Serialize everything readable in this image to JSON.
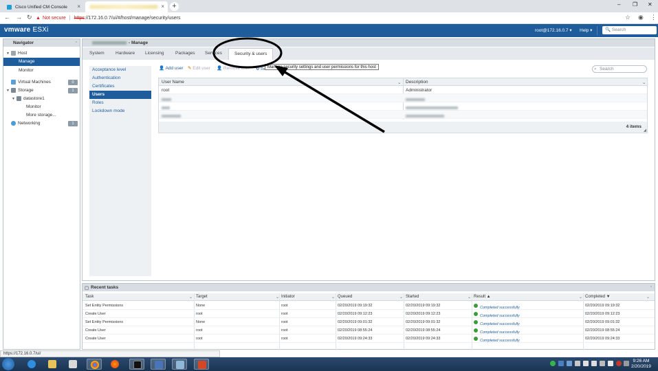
{
  "browser": {
    "tabs": [
      {
        "title": "Cisco Unified CM Console",
        "active": false
      },
      {
        "title": "",
        "active": true
      }
    ],
    "address": {
      "warning": "Not secure",
      "scheme": "https",
      "rest": "://172.16.0.7/ui/#/host/manage/security/users"
    },
    "status_url": "https://172.16.0.7/ui/"
  },
  "header": {
    "brand": "vmware",
    "product": "ESXi",
    "user": "root@172.16.0.7 ▾",
    "help": "Help ▾",
    "search_placeholder": "Search"
  },
  "navigator": {
    "title": "Navigator",
    "items": [
      {
        "label": "Host"
      },
      {
        "label": "Manage"
      },
      {
        "label": "Monitor"
      },
      {
        "label": "Virtual Machines",
        "badge": "0"
      },
      {
        "label": "Storage",
        "badge": "1"
      },
      {
        "label": "datastore1"
      },
      {
        "label": "Monitor"
      },
      {
        "label": "More storage..."
      },
      {
        "label": "Networking",
        "badge": "1"
      }
    ]
  },
  "main": {
    "title": "- Manage",
    "tabs": [
      "System",
      "Hardware",
      "Licensing",
      "Packages",
      "Services",
      "Security & users"
    ],
    "subnav": [
      "Acceptance level",
      "Authentication",
      "Certificates",
      "Users",
      "Roles",
      "Lockdown mode"
    ],
    "toolbar": {
      "add": "Add user",
      "edit": "Edit user",
      "remove": "Remove user",
      "refresh": "Refresh"
    },
    "tooltip": "Manage security settings and user permissions for this host",
    "search_placeholder": "Search",
    "grid": {
      "columns": [
        "User Name",
        "Description"
      ],
      "rows": [
        {
          "name": "root",
          "desc": "Administrator"
        }
      ],
      "footer": "4 items"
    }
  },
  "tasks": {
    "title": "Recent tasks",
    "columns": [
      "Task",
      "Target",
      "Initiator",
      "Queued",
      "Started",
      "Result ▲",
      "Completed ▼"
    ],
    "rows": [
      {
        "task": "Set Entity Permissions",
        "target": "None",
        "initiator": "root",
        "queued": "02/20/2019 09:19:32",
        "started": "02/20/2019 09:19:32",
        "result": "Completed successfully",
        "completed": "02/20/2019 09:19:32"
      },
      {
        "task": "Create User",
        "target": "root",
        "initiator": "root",
        "queued": "02/20/2019 09:12:23",
        "started": "02/20/2019 09:12:23",
        "result": "Completed successfully",
        "completed": "02/20/2019 09:12:23"
      },
      {
        "task": "Set Entity Permissions",
        "target": "None",
        "initiator": "root",
        "queued": "02/20/2019 09:01:32",
        "started": "02/20/2019 09:01:32",
        "result": "Completed successfully",
        "completed": "02/20/2019 09:01:32"
      },
      {
        "task": "Create User",
        "target": "root",
        "initiator": "root",
        "queued": "02/20/2019 08:55:24",
        "started": "02/20/2019 08:55:24",
        "result": "Completed successfully",
        "completed": "02/20/2019 08:55:24"
      },
      {
        "task": "Create User",
        "target": "root",
        "initiator": "root",
        "queued": "02/20/2019 09:24:33",
        "started": "02/20/2019 09:24:33",
        "result": "Completed successfully",
        "completed": "02/20/2019 09:24:33"
      }
    ]
  },
  "taskbar": {
    "time": "9:26 AM",
    "date": "2/20/2019"
  }
}
